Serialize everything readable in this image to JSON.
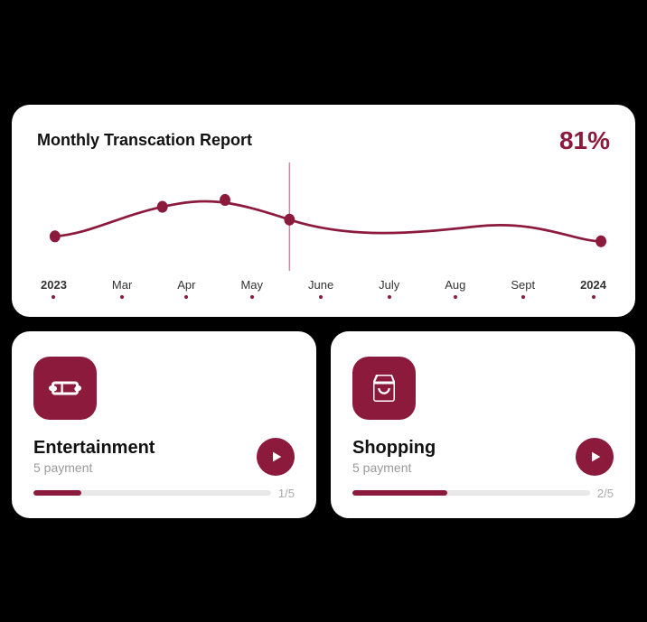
{
  "chart": {
    "title": "Monthly Transcation Report",
    "percent": "81%",
    "labels": [
      "2023",
      "Mar",
      "Apr",
      "May",
      "June",
      "July",
      "Aug",
      "Sept",
      "2024"
    ],
    "year_start": "2023",
    "year_end": "2024"
  },
  "categories": [
    {
      "id": "entertainment",
      "name": "Entertainment",
      "payment_label": "5 payment",
      "progress_current": 1,
      "progress_total": 5,
      "progress_pct": 20,
      "icon": "ticket"
    },
    {
      "id": "shopping",
      "name": "Shopping",
      "payment_label": "5 payment",
      "progress_current": 2,
      "progress_total": 5,
      "progress_pct": 40,
      "icon": "bag"
    }
  ]
}
